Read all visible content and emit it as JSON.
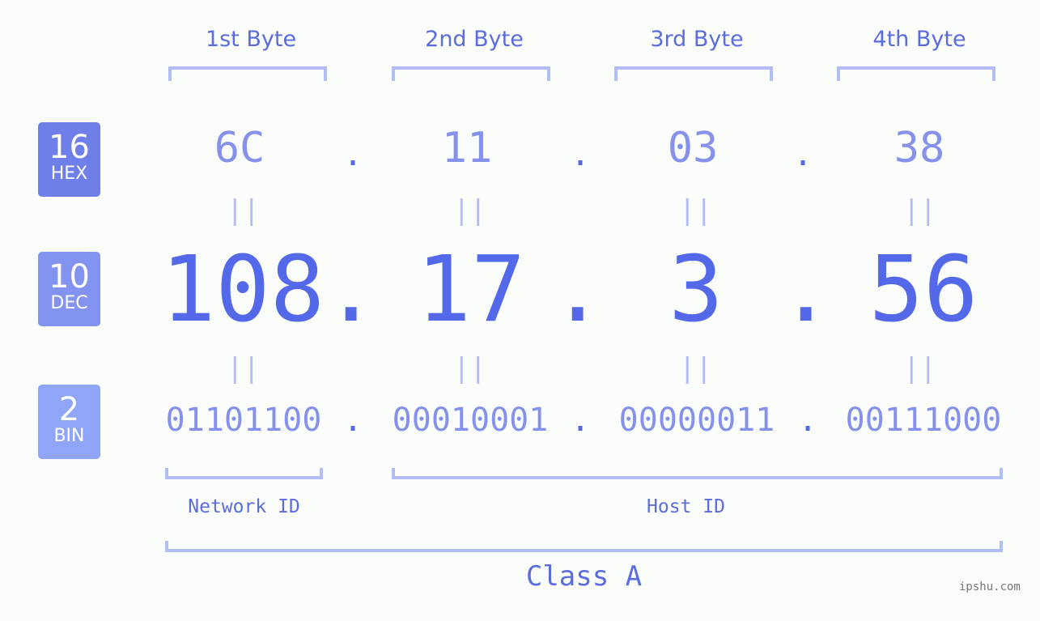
{
  "byte_headers": [
    "1st Byte",
    "2nd Byte",
    "3rd Byte",
    "4th Byte"
  ],
  "bases": [
    {
      "num": "16",
      "label": "HEX",
      "color": "#6e7fea"
    },
    {
      "num": "10",
      "label": "DEC",
      "color": "#8293f0"
    },
    {
      "num": "2",
      "label": "BIN",
      "color": "#8fa5f7"
    }
  ],
  "hex": [
    "6C",
    "11",
    "03",
    "38"
  ],
  "dec": [
    "108",
    "17",
    "3",
    "56"
  ],
  "bin": [
    "01101100",
    "00010001",
    "00000011",
    "00111000"
  ],
  "separator": ".",
  "equals": "||",
  "network_id_label": "Network ID",
  "host_id_label": "Host ID",
  "class_label": "Class A",
  "watermark": "ipshu.com",
  "colors": {
    "accent": "#5469e9",
    "light": "#8591ea",
    "bracket": "#b3bdf5"
  }
}
